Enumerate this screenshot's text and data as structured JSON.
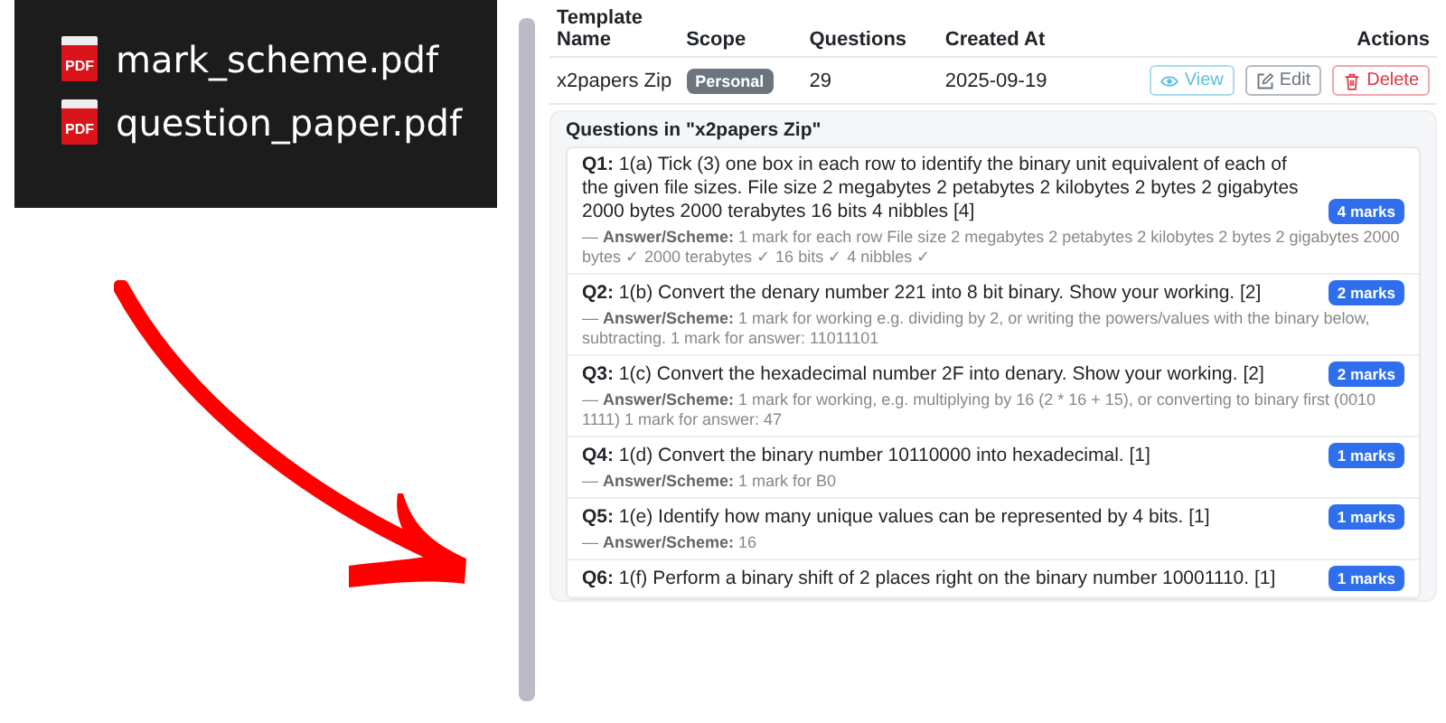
{
  "files": [
    {
      "icon_text": "PDF",
      "name": "mark_scheme.pdf"
    },
    {
      "icon_text": "PDF",
      "name": "question_paper.pdf"
    }
  ],
  "table": {
    "columns": [
      "Template Name",
      "Scope",
      "Questions",
      "Created At",
      "Actions"
    ],
    "rows": [
      {
        "name": "x2papers Zip",
        "scope": "Personal",
        "questions": "29",
        "created_at": "2025-09-19",
        "actions": [
          {
            "kind": "view",
            "label": "View"
          },
          {
            "kind": "edit",
            "label": "Edit"
          },
          {
            "kind": "delete",
            "label": "Delete"
          }
        ]
      }
    ]
  },
  "panel": {
    "title": "Questions in \"x2papers Zip\"",
    "questions": [
      {
        "text": "**Q1:** 1(a) Tick (3) one box in each row to identify the binary unit equivalent of each of the given file sizes. File size 2 megabytes 2 petabytes 2 kilobytes 2 bytes 2 gigabytes 2000 bytes 2000 terabytes 16 bits 4 nibbles [4]",
        "marks": "4 marks",
        "answer": "— **Answer/Scheme:** 1 mark for each row File size 2 megabytes 2 petabytes 2 kilobytes 2 bytes 2 gigabytes 2000 bytes ✓ 2000 terabytes ✓ 16 bits ✓ 4 nibbles ✓"
      },
      {
        "text": "**Q2:** 1(b) Convert the denary number 221 into 8 bit binary. Show your working. [2]",
        "marks": "2 marks",
        "answer": "— **Answer/Scheme:** 1 mark for working e.g. dividing by 2, or writing the powers/values with the binary below, subtracting. 1 mark for answer: 11011101"
      },
      {
        "text": "**Q3:** 1(c) Convert the hexadecimal number 2F into denary. Show your working. [2]",
        "marks": "2 marks",
        "answer": "— **Answer/Scheme:** 1 mark for working, e.g. multiplying by 16 (2 * 16 + 15), or converting to binary first (0010 1111) 1 mark for answer: 47"
      },
      {
        "text": "**Q4:** 1(d) Convert the binary number 10110000 into hexadecimal. [1]",
        "marks": "1 marks",
        "answer": "— **Answer/Scheme:** 1 mark for B0"
      },
      {
        "text": "**Q5:** 1(e) Identify how many unique values can be represented by 4 bits. [1]",
        "marks": "1 marks",
        "answer": "— **Answer/Scheme:** 16"
      },
      {
        "text": "**Q6:** 1(f) Perform a binary shift of 2 places right on the binary number 10001110. [1]",
        "marks": "1 marks"
      }
    ]
  }
}
